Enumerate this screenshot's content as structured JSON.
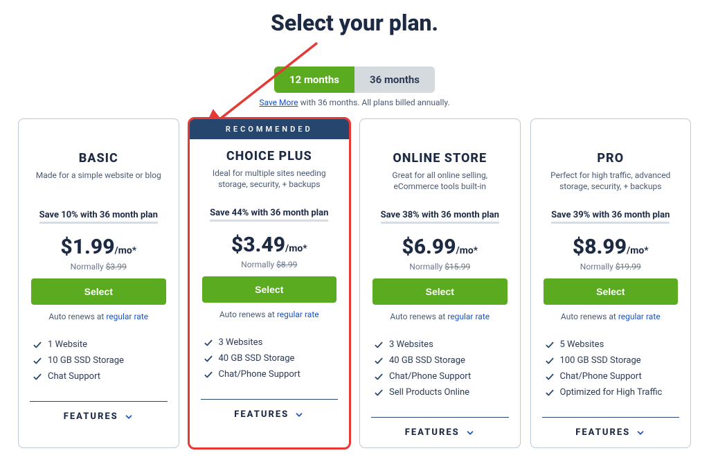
{
  "title": "Select your plan.",
  "toggle": {
    "option_a": "12 months",
    "option_b": "36 months",
    "active": "a",
    "note_link": "Save More",
    "note_rest": " with 36 months. All plans billed annually."
  },
  "common": {
    "select_label": "Select",
    "normally_prefix": "Normally ",
    "renew_prefix": "Auto renews at ",
    "renew_link": "regular rate",
    "features_toggle": "FEATURES",
    "recommended_label": "RECOMMENDED"
  },
  "plans": [
    {
      "id": "basic",
      "name": "BASIC",
      "desc": "Made for a simple website or blog",
      "save_line": "Save 10% with 36 month plan",
      "price": "$1.99",
      "suffix": "/mo*",
      "normally": "$3.99",
      "recommended": false,
      "highlighted": false,
      "features": [
        "1 Website",
        "10 GB SSD Storage",
        "Chat Support"
      ]
    },
    {
      "id": "choice-plus",
      "name": "CHOICE PLUS",
      "desc": "Ideal for multiple sites needing storage, security, + backups",
      "save_line": "Save 44% with 36 month plan",
      "price": "$3.49",
      "suffix": "/mo*",
      "normally": "$8.99",
      "recommended": true,
      "highlighted": true,
      "features": [
        "3 Websites",
        "40 GB SSD Storage",
        "Chat/Phone Support"
      ]
    },
    {
      "id": "online-store",
      "name": "ONLINE STORE",
      "desc": "Great for all online selling, eCommerce tools built-in",
      "save_line": "Save 38% with 36 month plan",
      "price": "$6.99",
      "suffix": "/mo*",
      "normally": "$15.99",
      "recommended": false,
      "highlighted": false,
      "features": [
        "3 Websites",
        "40 GB SSD Storage",
        "Chat/Phone Support",
        "Sell Products Online"
      ]
    },
    {
      "id": "pro",
      "name": "PRO",
      "desc": "Perfect for high traffic, advanced storage, security, + backups",
      "save_line": "Save 39% with 36 month plan",
      "price": "$8.99",
      "suffix": "/mo*",
      "normally": "$19.99",
      "recommended": false,
      "highlighted": false,
      "features": [
        "5 Websites",
        "100 GB SSD Storage",
        "Chat/Phone Support",
        "Optimized for High Traffic"
      ]
    }
  ]
}
